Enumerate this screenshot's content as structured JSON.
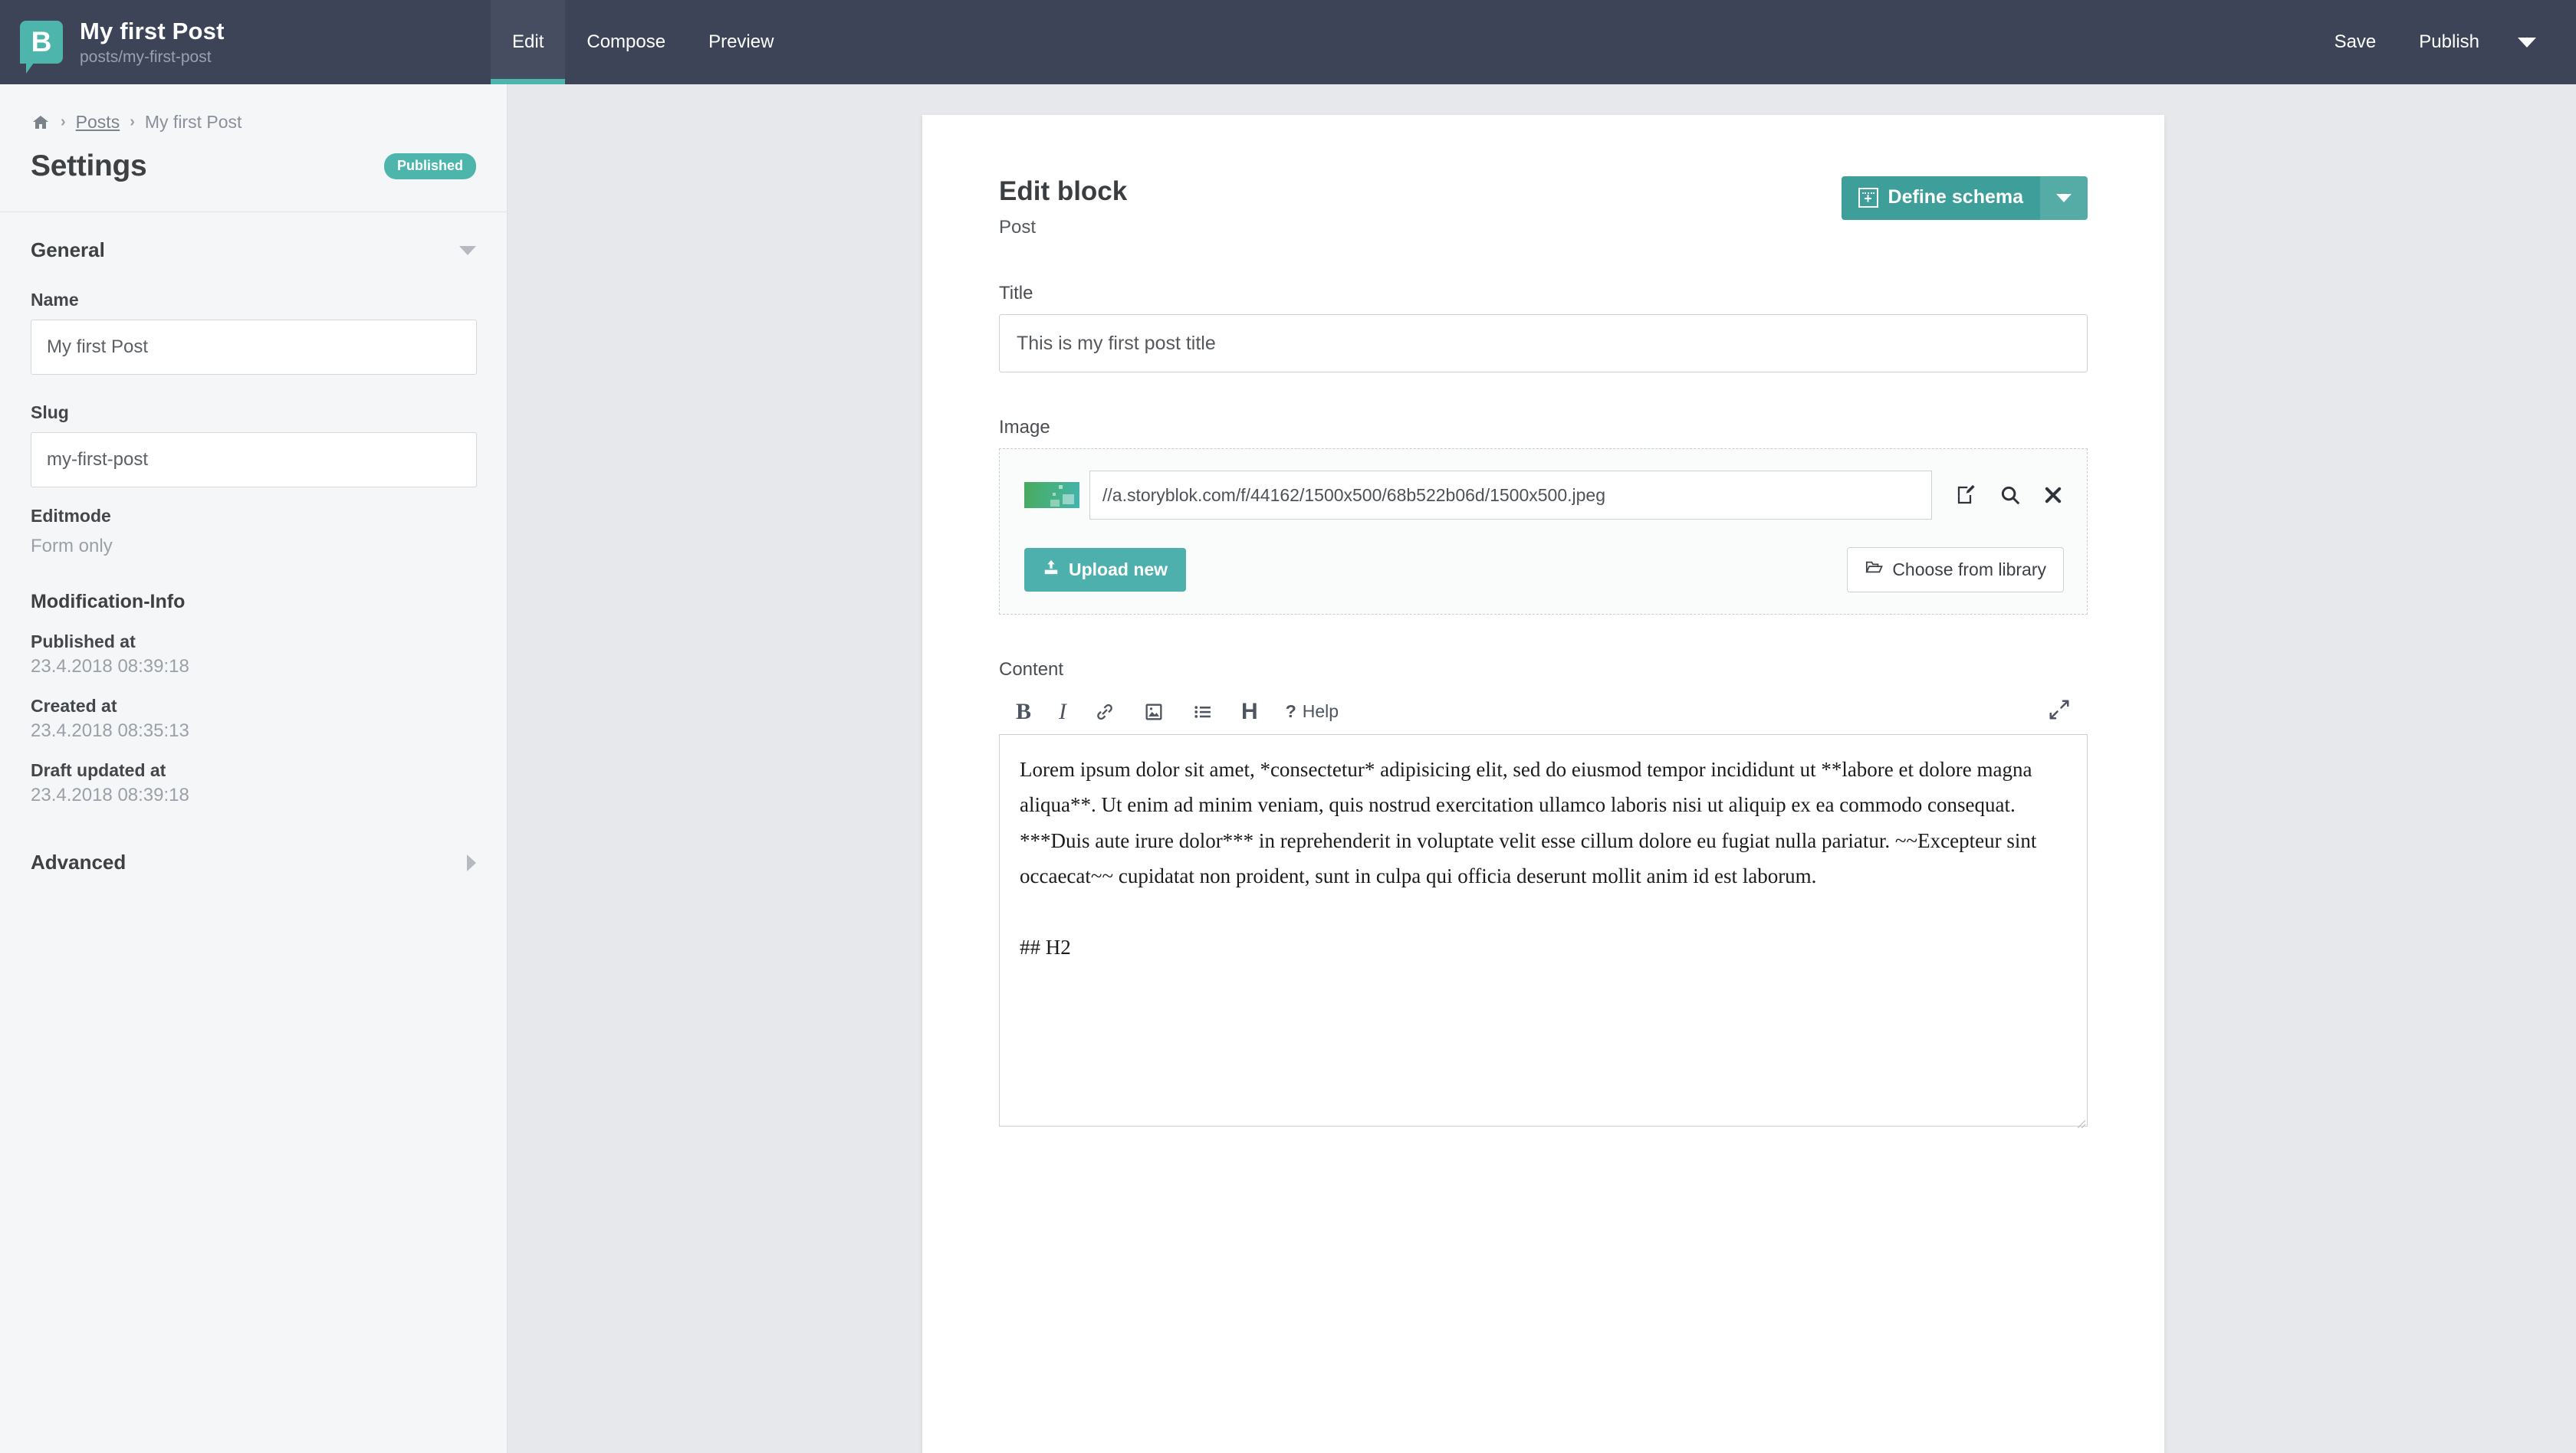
{
  "topbar": {
    "logo_icon": "storyblok-logo-icon",
    "logo_letter": "B",
    "title": "My first Post",
    "subtitle": "posts/my-first-post",
    "tabs": [
      {
        "label": "Edit",
        "active": true
      },
      {
        "label": "Compose",
        "active": false
      },
      {
        "label": "Preview",
        "active": false
      }
    ],
    "save_label": "Save",
    "publish_label": "Publish",
    "more_icon": "chevron-down-icon"
  },
  "sidebar": {
    "breadcrumb": {
      "home_icon": "home-icon",
      "separator": "›",
      "items": [
        "Posts",
        "My first Post"
      ]
    },
    "page_title": "Settings",
    "status_badge": "Published",
    "sections": [
      {
        "label": "General",
        "expanded": true,
        "icon": "chevron-down-icon"
      },
      {
        "label": "Advanced",
        "expanded": false,
        "icon": "chevron-right-icon"
      }
    ],
    "fields": {
      "name_label": "Name",
      "name_value": "My first Post",
      "slug_label": "Slug",
      "slug_value": "my-first-post",
      "editmode_label": "Editmode",
      "editmode_value": "Form only"
    },
    "modification": {
      "heading": "Modification-Info",
      "rows": [
        {
          "label": "Published at",
          "value": "23.4.2018 08:39:18"
        },
        {
          "label": "Created at",
          "value": "23.4.2018 08:35:13"
        },
        {
          "label": "Draft updated at",
          "value": "23.4.2018 08:39:18"
        }
      ]
    }
  },
  "panel": {
    "title": "Edit block",
    "subtitle": "Post",
    "schema_button": {
      "label": "Define schema",
      "icon": "schema-grid-plus-icon",
      "caret_icon": "chevron-down-icon"
    },
    "title_field": {
      "label": "Title",
      "value": "This is my first post title",
      "placeholder": ""
    },
    "image_field": {
      "label": "Image",
      "url_value": "//a.storyblok.com/f/44162/1500x500/68b522b06d/1500x500.jpeg",
      "thumbnail_icon": "image-thumbnail",
      "actions": [
        {
          "name": "edit-asset-icon",
          "title": "Edit"
        },
        {
          "name": "search-asset-icon",
          "title": "Search"
        },
        {
          "name": "remove-asset-icon",
          "title": "Remove"
        }
      ],
      "upload_label": "Upload new",
      "upload_icon": "upload-icon",
      "library_label": "Choose from library",
      "library_icon": "folder-open-icon"
    },
    "content_field": {
      "label": "Content",
      "toolbar": [
        {
          "name": "bold-icon",
          "glyph": "B"
        },
        {
          "name": "italic-icon",
          "glyph": "I"
        },
        {
          "name": "link-icon",
          "glyph": ""
        },
        {
          "name": "image-icon",
          "glyph": ""
        },
        {
          "name": "bullet-list-icon",
          "glyph": ""
        },
        {
          "name": "heading-icon",
          "glyph": "H"
        }
      ],
      "help_label": "Help",
      "help_icon": "question-mark-icon",
      "expand_icon": "fullscreen-expand-icon",
      "value": "Lorem ipsum dolor sit amet, *consectetur* adipisicing elit, sed do eiusmod tempor incididunt ut **labore et dolore magna aliqua**. Ut enim ad minim veniam, quis nostrud exercitation ullamco laboris nisi ut aliquip ex ea commodo consequat. ***Duis aute irure dolor*** in reprehenderit in voluptate velit esse cillum dolore eu fugiat nulla pariatur. ~~Excepteur sint occaecat~~ cupidatat non proident, sunt in culpa qui officia deserunt mollit anim id est laborum.\n\n## H2"
    }
  },
  "colors": {
    "topbar_bg": "#3e4457",
    "accent_teal": "#4eb5ac",
    "schema_btn": "#3e9e99",
    "canvas_bg": "#e6e8eb",
    "sidebar_bg": "#f5f6f7"
  }
}
